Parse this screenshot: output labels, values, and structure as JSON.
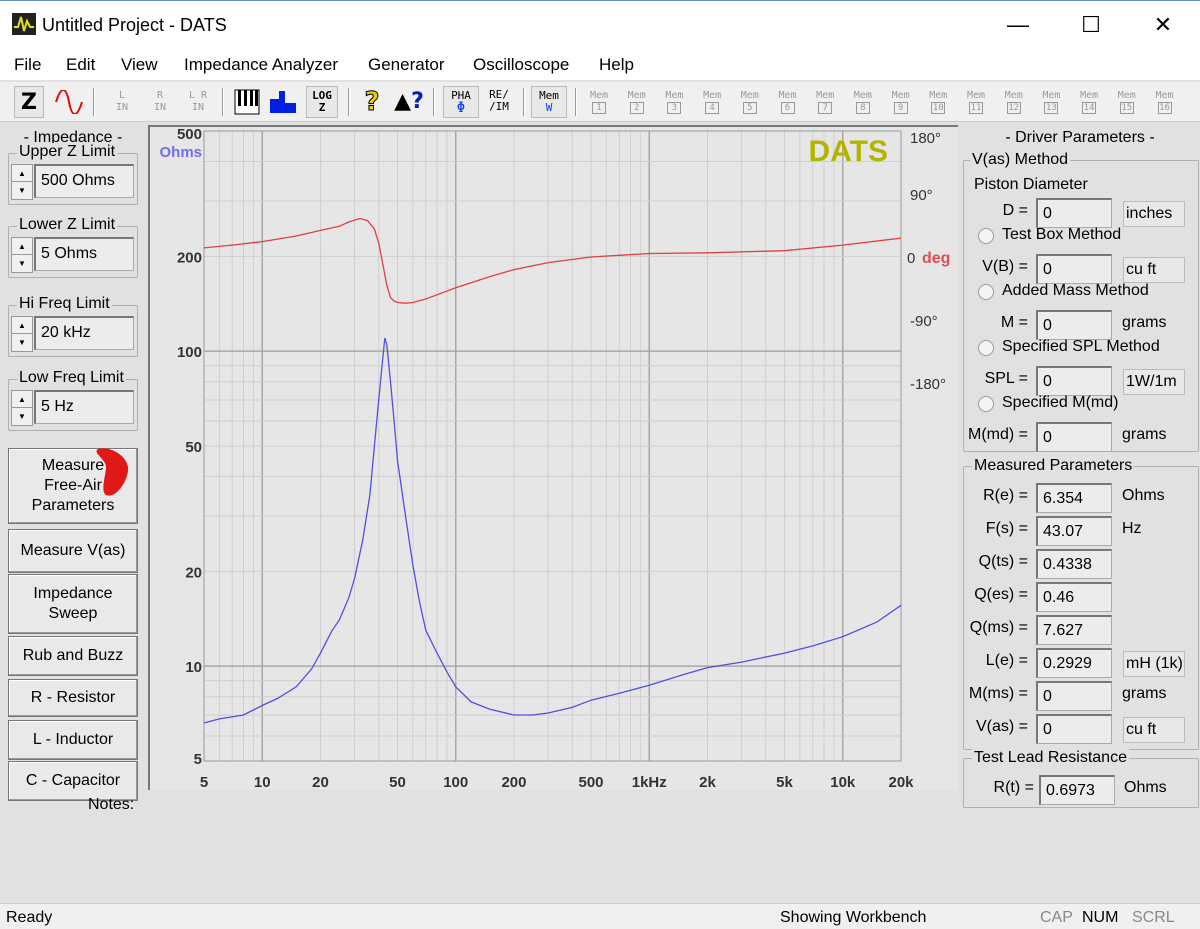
{
  "window": {
    "title": "Untitled Project - DATS",
    "minimize": "—",
    "maximize": "☐",
    "close": "✕"
  },
  "menu": [
    "File",
    "Edit",
    "View",
    "Impedance Analyzer",
    "Generator",
    "Oscilloscope",
    "Help"
  ],
  "toolbar": {
    "z": "Z",
    "l_in": [
      "L",
      "IN"
    ],
    "r_in": [
      "R",
      "IN"
    ],
    "lr_in": [
      "L R",
      "IN"
    ],
    "log_z": [
      "LOG",
      "Z"
    ],
    "help": "?",
    "context_help": "?",
    "pha": [
      "PHA",
      "Φ"
    ],
    "reim": [
      "RE/",
      "/IM"
    ],
    "mem_w": [
      "Mem",
      "W"
    ],
    "mem_label": "Mem",
    "mem_slots": [
      "1",
      "2",
      "3",
      "4",
      "5",
      "6",
      "7",
      "8",
      "9",
      "10",
      "11",
      "12",
      "13",
      "14",
      "15",
      "16"
    ]
  },
  "left": {
    "heading": "- Impedance -",
    "upper_z": {
      "label": "Upper Z Limit",
      "value": "500 Ohms"
    },
    "lower_z": {
      "label": "Lower Z Limit",
      "value": "5 Ohms"
    },
    "hi_freq": {
      "label": "Hi Freq Limit",
      "value": "20 kHz"
    },
    "low_freq": {
      "label": "Low Freq Limit",
      "value": "5 Hz"
    },
    "buttons": [
      "Measure Free-Air Parameters",
      "Measure V(as)",
      "Impedance Sweep",
      "Rub and Buzz",
      "R - Resistor",
      "L - Inductor",
      "C - Capacitor"
    ]
  },
  "notes_label": "Notes:",
  "chart_data": {
    "type": "line",
    "watermark": "DATS",
    "x_scale": "log",
    "xlim": [
      5,
      20000
    ],
    "x_ticks": [
      5,
      10,
      20,
      50,
      100,
      200,
      500,
      1000,
      2000,
      5000,
      10000,
      20000
    ],
    "x_tick_labels": [
      "5",
      "10",
      "20",
      "50",
      "100",
      "200",
      "500",
      "1kHz",
      "2k",
      "5k",
      "10k",
      "20k"
    ],
    "y_left": {
      "unit": "Ohms",
      "scale": "log",
      "lim": [
        5,
        500
      ],
      "ticks": [
        500,
        200,
        100,
        50,
        20,
        10,
        5
      ],
      "tick_labels": [
        "500",
        "200",
        "100",
        "50",
        "20",
        "10",
        "5"
      ],
      "color": "#6f6fe8"
    },
    "y_right": {
      "unit": "deg",
      "lim": [
        -180,
        180
      ],
      "tick_labels": [
        "180°",
        "90°",
        "0",
        "-90°",
        "-180°"
      ],
      "ticks": [
        180,
        90,
        0,
        -90,
        -180
      ],
      "color": "#e05050"
    },
    "grid": true,
    "series": [
      {
        "axis": "left",
        "color": "#5050e0",
        "x": [
          5,
          6,
          8,
          10,
          12,
          15,
          18,
          20,
          23,
          25,
          28,
          30,
          33,
          36,
          38,
          40,
          42,
          43,
          44,
          46,
          48,
          50,
          55,
          60,
          65,
          70,
          80,
          90,
          100,
          120,
          150,
          200,
          250,
          300,
          400,
          500,
          700,
          1000,
          1500,
          2000,
          3000,
          5000,
          7000,
          10000,
          15000,
          20000
        ],
        "y": [
          6.6,
          6.8,
          7.0,
          7.5,
          7.9,
          8.6,
          9.8,
          11,
          13,
          14,
          16.5,
          19,
          25,
          35,
          50,
          70,
          95,
          110,
          105,
          80,
          60,
          45,
          30,
          21,
          16,
          13,
          11,
          9.6,
          8.6,
          7.7,
          7.3,
          7.0,
          7.0,
          7.1,
          7.4,
          7.8,
          8.2,
          8.7,
          9.4,
          9.9,
          10.3,
          11.0,
          11.6,
          12.4,
          13.8,
          15.6
        ]
      },
      {
        "axis": "right",
        "color": "#e04040",
        "x": [
          5,
          7,
          10,
          15,
          20,
          25,
          28,
          32,
          35,
          38,
          40,
          42,
          44,
          46,
          48,
          50,
          55,
          60,
          70,
          80,
          100,
          150,
          200,
          300,
          500,
          1000,
          2000,
          5000,
          10000,
          20000
        ],
        "y": [
          13,
          17,
          22,
          30,
          38,
          44,
          50,
          55,
          52,
          40,
          20,
          -10,
          -40,
          -58,
          -63,
          -65,
          -66,
          -65,
          -60,
          -54,
          -44,
          -28,
          -18,
          -8,
          0,
          5,
          6,
          9,
          17,
          27
        ]
      }
    ]
  },
  "right": {
    "heading": "- Driver Parameters -",
    "vas_method": {
      "label": "V(as) Method",
      "piston": "Piston Diameter",
      "rows": [
        {
          "label": "D =",
          "value": "0",
          "unit": "inches",
          "unit_boxed": true
        },
        {
          "radio": "Test Box Method",
          "label": "V(B) =",
          "value": "0",
          "unit": "cu ft",
          "unit_boxed": true
        },
        {
          "radio": "Added Mass Method",
          "label": "M =",
          "value": "0",
          "unit": "grams",
          "unit_boxed": false
        },
        {
          "radio": "Specified SPL Method",
          "label": "SPL =",
          "value": "0",
          "unit": "1W/1m",
          "unit_boxed": true
        },
        {
          "radio": "Specified M(md)",
          "label": "M(md) =",
          "value": "0",
          "unit": "grams",
          "unit_boxed": false
        }
      ]
    },
    "measured": {
      "label": "Measured Parameters",
      "rows": [
        {
          "label": "R(e) =",
          "value": "6.354",
          "unit": "Ohms",
          "unit_boxed": false
        },
        {
          "label": "F(s) =",
          "value": "43.07",
          "unit": "Hz",
          "unit_boxed": false
        },
        {
          "label": "Q(ts) =",
          "value": "0.4338",
          "unit": "",
          "unit_boxed": false
        },
        {
          "label": "Q(es) =",
          "value": "0.46",
          "unit": "",
          "unit_boxed": false
        },
        {
          "label": "Q(ms) =",
          "value": "7.627",
          "unit": "",
          "unit_boxed": false
        },
        {
          "label": "L(e) =",
          "value": "0.2929",
          "unit": "mH (1k)",
          "unit_boxed": true
        },
        {
          "label": "M(ms) =",
          "value": "0",
          "unit": "grams",
          "unit_boxed": false
        },
        {
          "label": "V(as) =",
          "value": "0",
          "unit": "cu ft",
          "unit_boxed": true
        }
      ]
    },
    "test_lead": {
      "label": "Test Lead Resistance",
      "row": {
        "label": "R(t) =",
        "value": "0.6973",
        "unit": "Ohms"
      }
    }
  },
  "status": {
    "left": "Ready",
    "center": "Showing Workbench",
    "cap": "CAP",
    "num": "NUM",
    "scrl": "SCRL"
  }
}
